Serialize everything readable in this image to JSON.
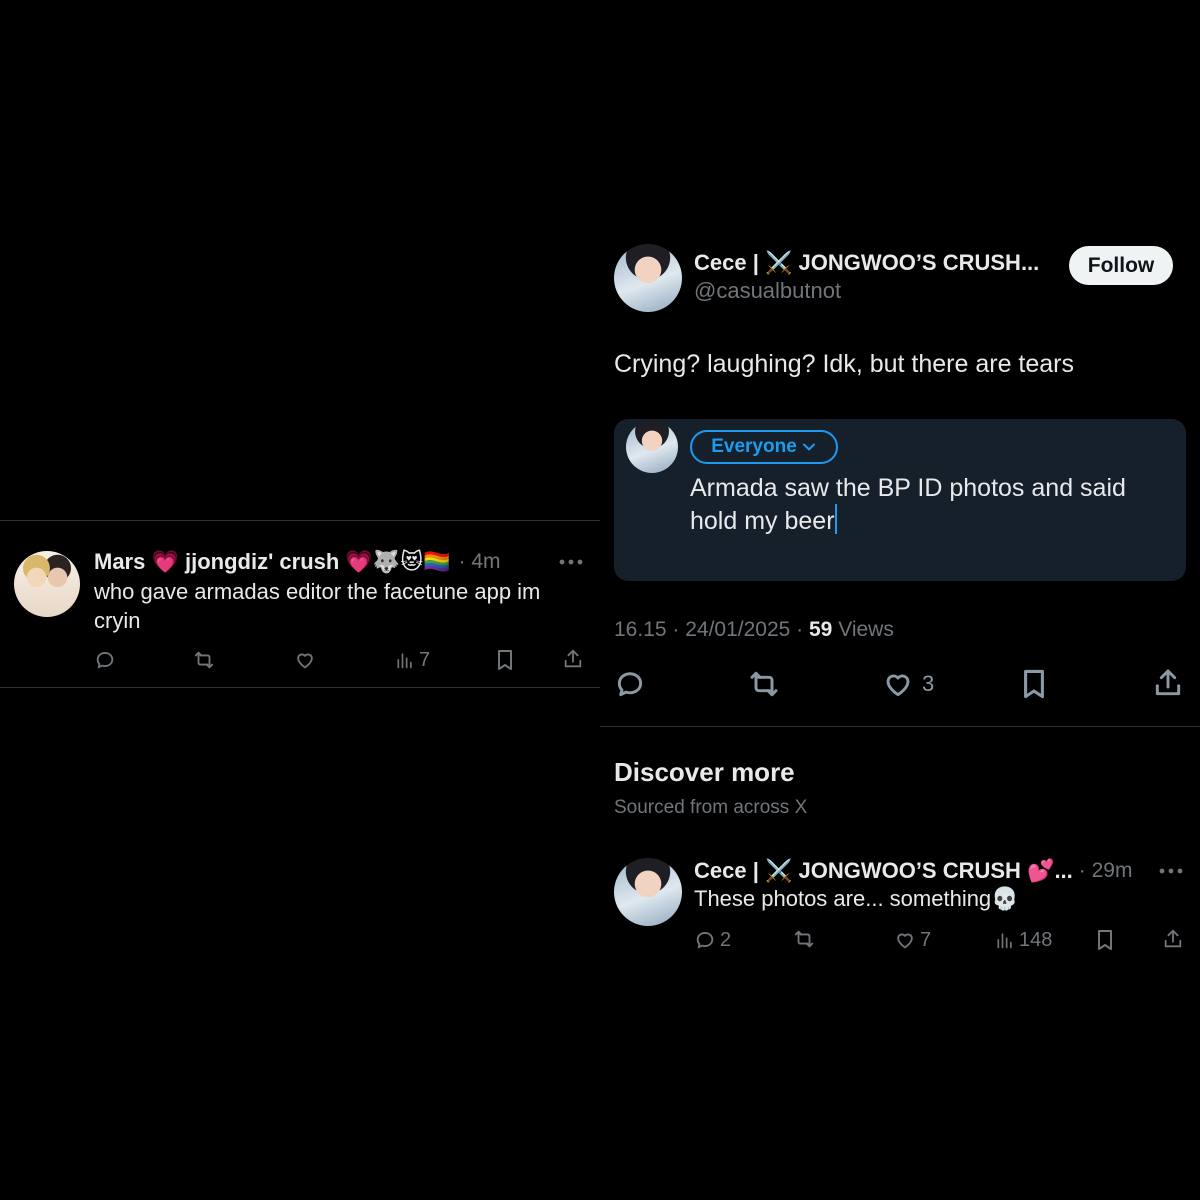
{
  "left_tweet": {
    "name": "Mars 💗 jjongdiz' crush 💗🐺😻🏳️‍🌈",
    "time": "· 4m",
    "text": "who gave armadas editor the facetune app im cryin",
    "views": "7",
    "more_icon": "more-icon"
  },
  "main_tweet": {
    "name": "Cece | ⚔️ JONGWOO’S CRUSH...",
    "handle": "@casualbutnot",
    "follow_label": "Follow",
    "text": "Crying? laughing? Idk, but there are tears",
    "reply_box": {
      "audience_label": "Everyone",
      "draft_text": "Armada saw the BP ID photos and said hold my beer"
    },
    "meta_time_date": "16.15 · 24/01/2025 ·",
    "views_count": "59",
    "views_label": "Views",
    "like_count": "3"
  },
  "discover": {
    "title": "Discover more",
    "subtitle": "Sourced from across X",
    "tweet": {
      "name": "Cece | ⚔️ JONGWOO’S CRUSH 💕...",
      "time": "· 29m",
      "text": "These photos are... something💀",
      "reply_count": "2",
      "like_count": "7",
      "view_count": "148"
    }
  },
  "colors": {
    "background": "#000000",
    "accent": "#1d9bf0",
    "muted": "#71767b",
    "compose_bg": "#16202a"
  }
}
